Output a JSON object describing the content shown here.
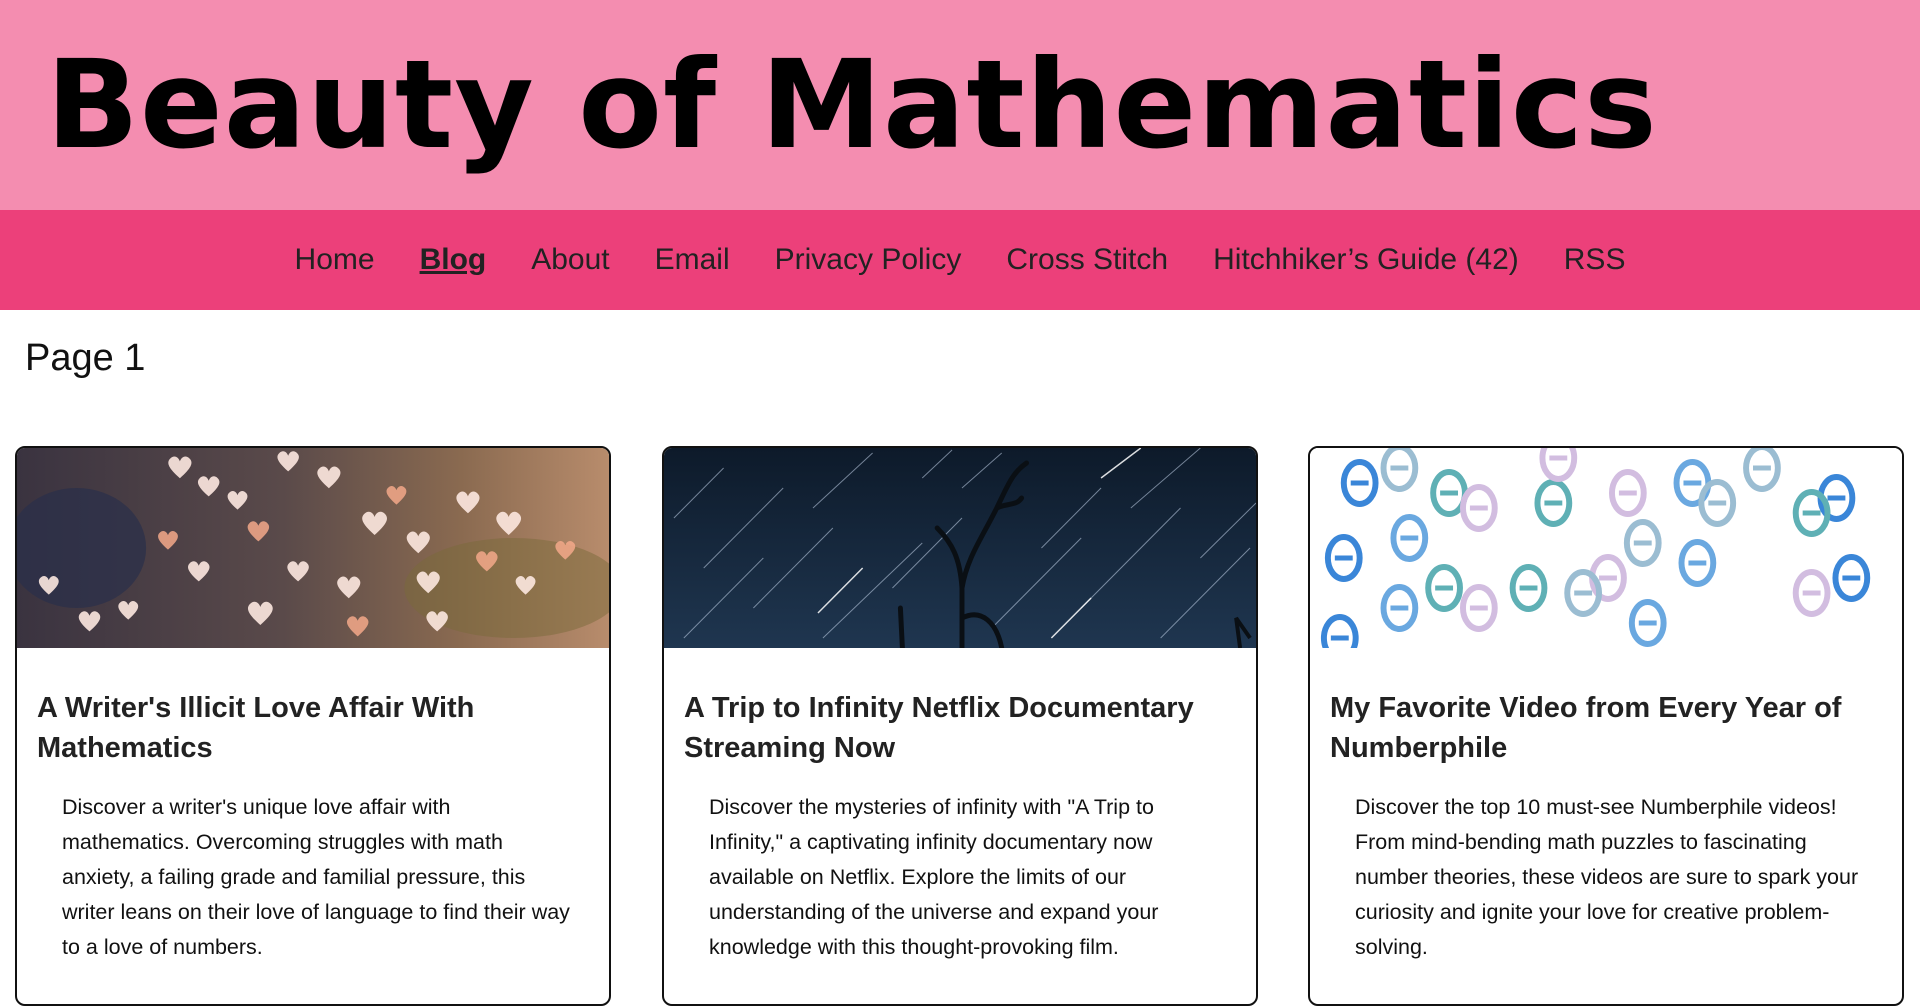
{
  "site": {
    "title": "Beauty of Mathematics"
  },
  "nav": {
    "items": [
      {
        "label": "Home",
        "active": false
      },
      {
        "label": "Blog",
        "active": true
      },
      {
        "label": "About",
        "active": false
      },
      {
        "label": "Email",
        "active": false
      },
      {
        "label": "Privacy Policy",
        "active": false
      },
      {
        "label": "Cross Stitch",
        "active": false
      },
      {
        "label": "Hitchhiker’s Guide (42)",
        "active": false
      },
      {
        "label": "RSS",
        "active": false
      }
    ]
  },
  "page": {
    "heading": "Page 1"
  },
  "posts": [
    {
      "title": "A Writer's Illicit Love Affair With Mathematics",
      "description": "Discover a writer's unique love affair with mathematics. Overcoming struggles with math anxiety, a failing grade and familial pressure, this writer leans on their love of language to find their way to a love of numbers.",
      "image": "bokeh-hearts-image"
    },
    {
      "title": "A Trip to Infinity Netflix Documentary Streaming Now",
      "description": "Discover the mysteries of infinity with \"A Trip to Infinity,\" a captivating infinity documentary now available on Netflix. Explore the limits of our understanding of the universe and expand your knowledge with this thought-provoking film.",
      "image": "star-trails-image"
    },
    {
      "title": "My Favorite Video from Every Year of Numberphile",
      "description": "Discover the top 10 must-see Numberphile videos! From mind-bending math puzzles to fascinating number theories, these videos are sure to spark your curiosity and ignite your love for creative problem-solving.",
      "image": "theta-symbols-image"
    }
  ],
  "colors": {
    "header_bg": "#f48db0",
    "nav_bg": "#ec407a"
  }
}
